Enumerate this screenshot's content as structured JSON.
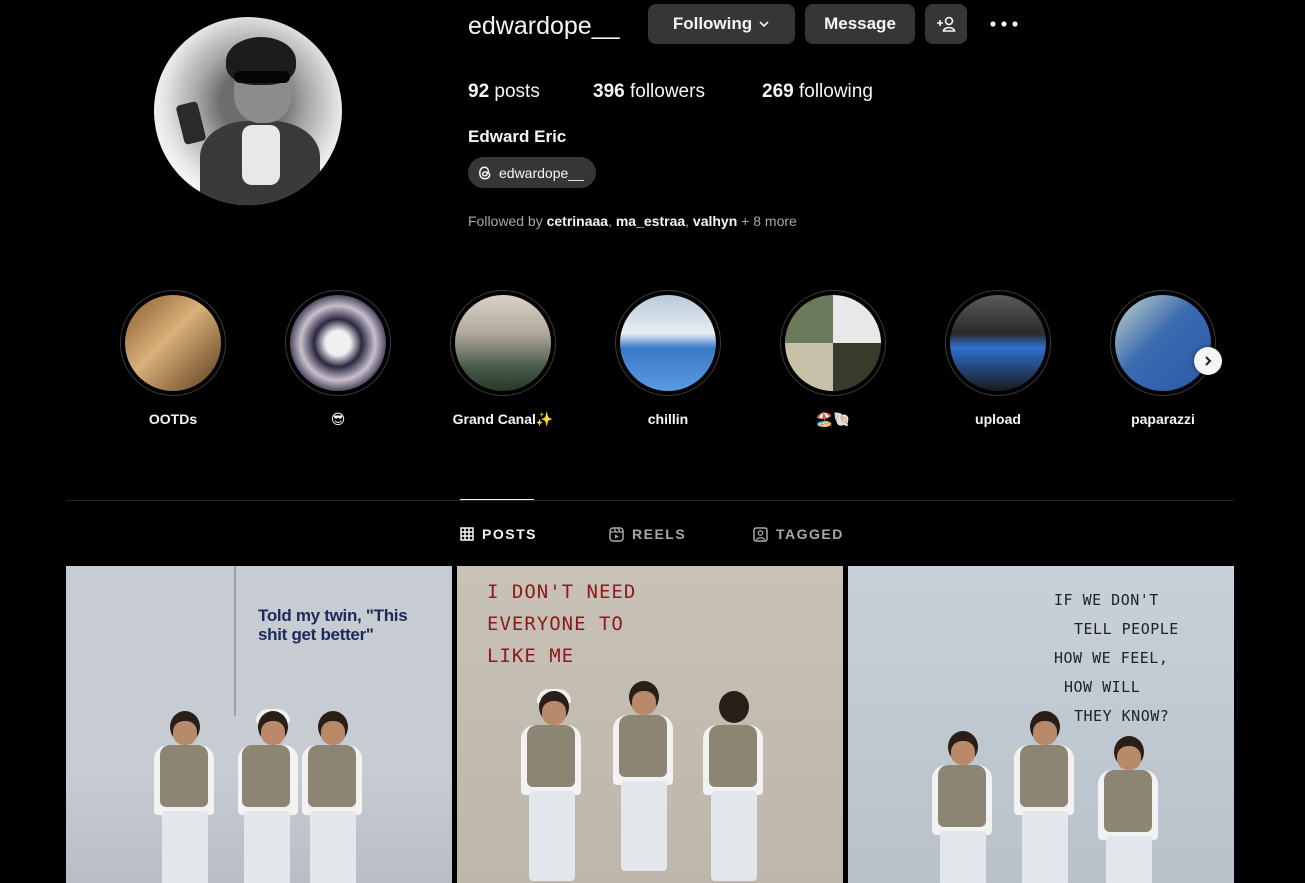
{
  "profile": {
    "username": "edwardope__",
    "full_name": "Edward Eric",
    "threads_handle": "edwardope__",
    "stats": {
      "posts_count": "92",
      "posts_label": "posts",
      "followers_count": "396",
      "followers_label": "followers",
      "following_count": "269",
      "following_label": "following"
    },
    "followed_by": {
      "prefix": "Followed by ",
      "names": [
        "cetrinaaa",
        "ma_estraa",
        "valhyn"
      ],
      "sep": ", ",
      "more": " + 8 more"
    }
  },
  "actions": {
    "following_label": "Following",
    "message_label": "Message"
  },
  "highlights": [
    {
      "label": "OOTDs"
    },
    {
      "label": "😎"
    },
    {
      "label": "Grand Canal✨"
    },
    {
      "label": "chillin"
    },
    {
      "label": "🏖️🐚"
    },
    {
      "label": "upload"
    },
    {
      "label": "paparazzi"
    }
  ],
  "tabs": {
    "posts": "POSTS",
    "reels": "REELS",
    "tagged": "TAGGED"
  },
  "posts": [
    {
      "caption": "Told my twin, \"This shit get better\""
    },
    {
      "caption_lines": [
        "I DON'T NEED",
        "EVERYONE TO",
        "LIKE ME"
      ]
    },
    {
      "caption_lines": [
        "IF WE DON'T",
        "TELL PEOPLE",
        "HOW WE FEEL,",
        "HOW WILL",
        "THEY KNOW?"
      ]
    }
  ],
  "colors": {
    "background": "#000000",
    "button": "#363636",
    "muted_text": "#a8a8a8",
    "text": "#f5f5f5"
  }
}
